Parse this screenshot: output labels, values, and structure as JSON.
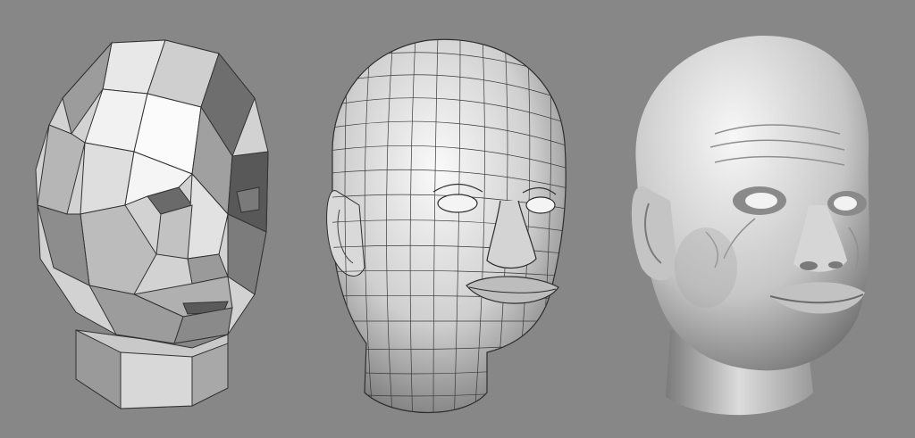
{
  "scene": {
    "background_color": "#878787",
    "panels": [
      {
        "name": "low-poly-head",
        "style": "faceted flat-shaded polygon mesh"
      },
      {
        "name": "wireframe-head",
        "style": "subdivided mesh with quad wireframe overlay"
      },
      {
        "name": "sculpted-head",
        "style": "smooth high-detail sculpt"
      }
    ],
    "colors": {
      "light": "#f4f4f4",
      "mid": "#bdbdbd",
      "dark": "#5e5e5e",
      "edge": "#2e2e2e"
    }
  }
}
